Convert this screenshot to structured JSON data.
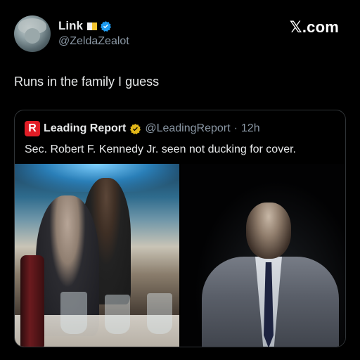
{
  "post": {
    "author_name": "Link",
    "author_handle": "@ZeldaZealot",
    "text": "Runs in the family I guess",
    "icons": [
      "flag-icon",
      "verified-icon"
    ]
  },
  "watermark": "𝕏.com",
  "quote": {
    "logo_letter": "R",
    "author_name": "Leading Report",
    "author_handle": "@LeadingReport",
    "separator": "·",
    "time": "12h",
    "text": "Sec. Robert F. Kennedy Jr. seen not ducking for cover.",
    "icons": [
      "leading-report-logo",
      "gold-check-icon"
    ],
    "colors": {
      "logo": "#e11d26",
      "gold_check": "#e2b719",
      "verified_blue": "#1d9bf0"
    }
  }
}
